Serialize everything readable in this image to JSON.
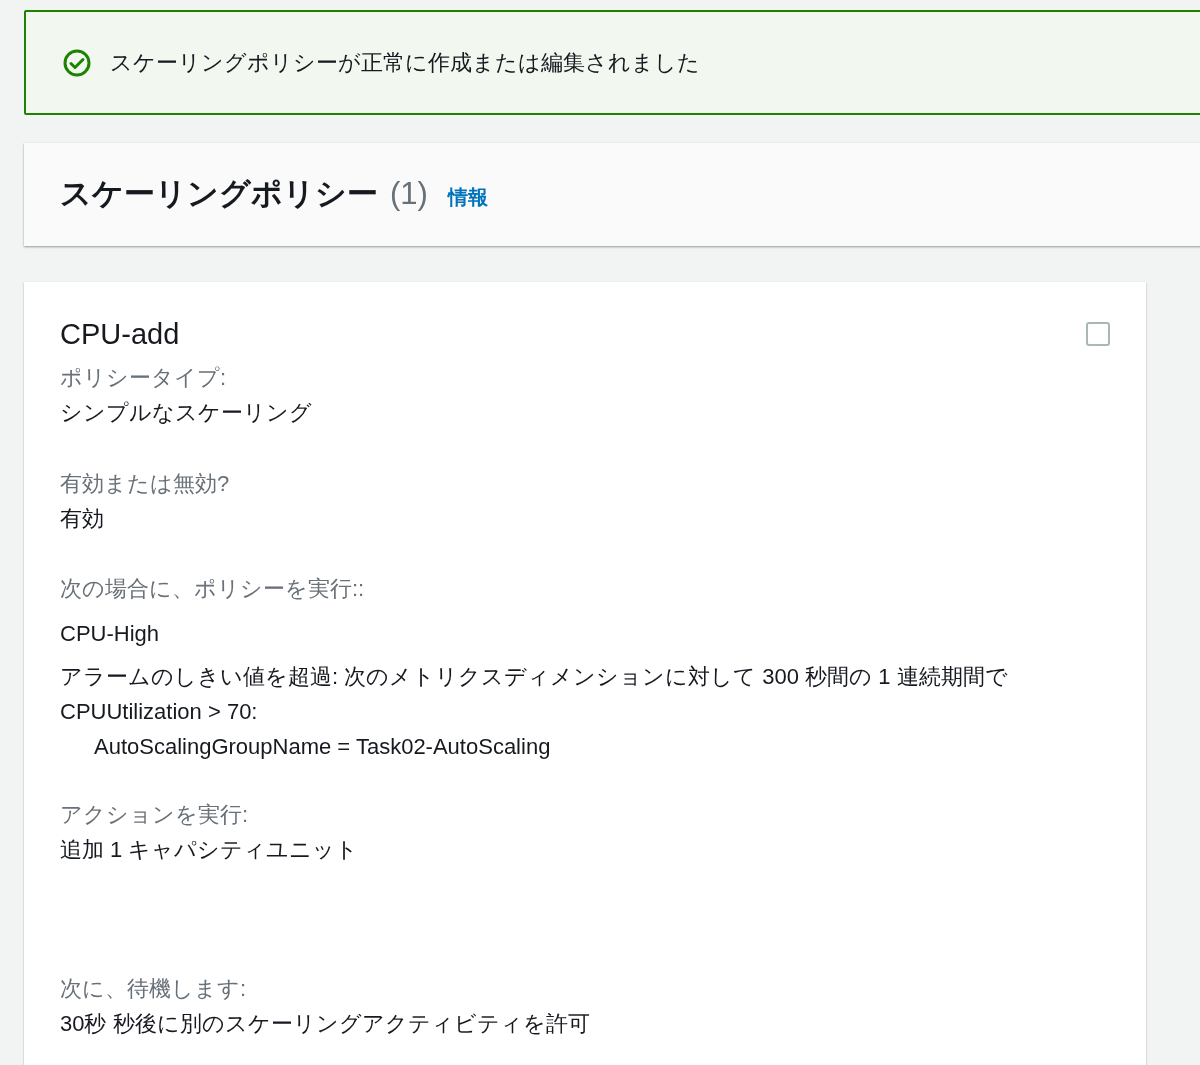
{
  "alert": {
    "kind": "success",
    "message": "スケーリングポリシーが正常に作成または編集されました"
  },
  "header": {
    "title": "スケーリングポリシー",
    "count": "(1)",
    "info_link": "情報"
  },
  "policy": {
    "name": "CPU-add",
    "checked": false,
    "policy_type": {
      "label": "ポリシータイプ:",
      "value": "シンプルなスケーリング"
    },
    "enabled": {
      "label": "有効または無効?",
      "value": "有効"
    },
    "trigger": {
      "label": "次の場合に、ポリシーを実行::",
      "alarm_name": "CPU-High",
      "description": "アラームのしきい値を超過: 次のメトリクスディメンションに対して 300 秒間の 1 連続期間で",
      "condition": "CPUUtilization > 70:",
      "dimension": "AutoScalingGroupName = Task02-AutoScaling"
    },
    "action": {
      "label": "アクションを実行:",
      "value": "追加 1 キャパシティユニット"
    },
    "cooldown": {
      "label": "次に、待機します:",
      "value": "30秒 秒後に別のスケーリングアクティビティを許可"
    }
  }
}
